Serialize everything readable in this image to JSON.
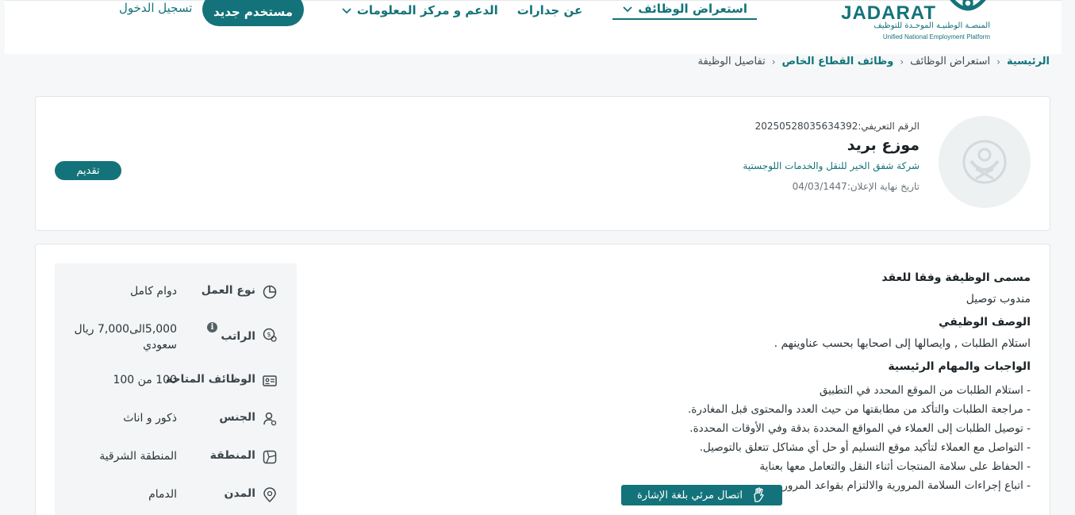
{
  "header": {
    "logo_title": "JADARAT",
    "logo_ar": "المنصـة الوطنيـة الموحـدة للتوظيف",
    "logo_en": "Unified National Employment Platform",
    "nav": [
      {
        "label": "استعراض الوظائف"
      },
      {
        "label": "عن جدارات"
      },
      {
        "label": "الدعم و مركز المعلومات"
      }
    ],
    "register_label": "مستخدم جديد",
    "login_label": "تسجيل الدخول"
  },
  "breadcrumb": {
    "home": "الرئيسية",
    "jobs": "استعراض الوظائف",
    "private": "وظائف القطاع الخاص",
    "current": "تفاصيل الوظيفة"
  },
  "job": {
    "id": "الرقم التعريفي:20250528035634392",
    "title": "موزع بريد",
    "company": "شركة شفق الخير للنقل والخدمات اللوجستية",
    "deadline": "تاريخ نهاية الإعلان:04/03/1447",
    "apply_label": "تقديم"
  },
  "details": {
    "contract_title_heading": "مسمى الوظيفة وفقا للعقد",
    "contract_title": "مندوب توصيل",
    "description_heading": "الوصف الوظيفي",
    "description": "استلام الطلبات , وايصالها إلى اصحابها بحسب عناوينهم .",
    "duties_heading": "الواجبات والمهام الرئيسية",
    "duties": [
      "- استلام الطلبات من الموقع المحدد في التطبيق",
      "- مراجعة الطلبات والتأكد من مطابقتها من حيث العدد والمحتوى قبل المغادرة.",
      "- توصيل الطلبات إلى العملاء في المواقع المحددة بدقة وفي الأوقات المحددة.",
      "- التواصل مع العملاء لتأكيد موقع التسليم أو حل أي مشاكل تتعلق بالتوصيل.",
      "- الحفاظ على سلامة المنتجات أثناء النقل والتعامل معها بعناية",
      "- اتباع إجراءات السلامة المرورية والالتزام بقواعد المرور"
    ]
  },
  "sidebar": {
    "work_type": {
      "label": "نوع العمل",
      "value": "دوام كامل",
      "icon": "clock-pie-icon"
    },
    "salary": {
      "label": "الراتب",
      "value": "5,000الى7,000 ريال سعودي",
      "icon": "money-icon"
    },
    "vacancies": {
      "label": "الوظائف المتاحة",
      "value": "100 من 100",
      "icon": "id-card-icon"
    },
    "gender": {
      "label": "الجنس",
      "value": "ذكور و اناث",
      "icon": "user-gender-icon"
    },
    "region": {
      "label": "المنطقة",
      "value": "المنطقة الشرقية",
      "icon": "map-icon"
    },
    "city": {
      "label": "المدن",
      "value": "الدمام",
      "icon": "location-pin-icon"
    }
  },
  "sign_language": {
    "label": "اتصال مرئي بلغة الإشارة"
  },
  "colors": {
    "primary": "#14737a",
    "background": "#f5f7f8"
  }
}
